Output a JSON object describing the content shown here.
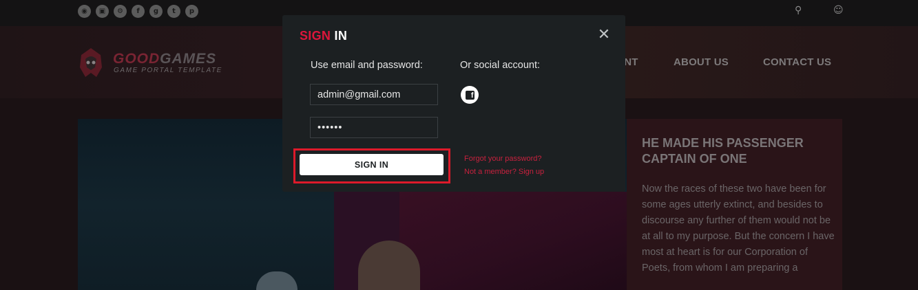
{
  "topbar": {
    "social_icons": [
      {
        "name": "rss-icon",
        "glyph": "◉"
      },
      {
        "name": "twitch-icon",
        "glyph": "▣"
      },
      {
        "name": "steam-icon",
        "glyph": "⚙"
      },
      {
        "name": "facebook-icon",
        "glyph": "f"
      },
      {
        "name": "google-plus-icon",
        "glyph": "g"
      },
      {
        "name": "twitter-icon",
        "glyph": "t"
      },
      {
        "name": "pinterest-icon",
        "glyph": "p"
      }
    ],
    "search_icon": "⚲",
    "user_icon": "☺"
  },
  "logo": {
    "name_part1": "GOOD",
    "name_part2": "GAMES",
    "tagline": "GAME PORTAL TEMPLATE"
  },
  "nav": {
    "partial_item": "ENT",
    "about": "ABOUT US",
    "contact": "CONTACT US"
  },
  "article": {
    "title": "HE MADE HIS PASSENGER CAPTAIN OF ONE",
    "body": "Now the races of these two have been for some ages utterly extinct, and besides to discourse any further of them would not be at all to my purpose. But the concern I have most at heart is for our Corporation of Poets, from whom I am preparing a"
  },
  "modal": {
    "title_part1": "SIGN",
    "title_part2": " IN",
    "close_glyph": "✕",
    "email_label": "Use email and password:",
    "social_label": "Or social account:",
    "email_value": "admin@gmail.com",
    "password_value": "••••••",
    "facebook_glyph": "f",
    "signin_button": "SIGN IN",
    "forgot_link": "Forgot your password?",
    "signup_link": "Not a member? Sign up"
  },
  "colors": {
    "accent": "#dd163b",
    "modal_bg": "#1c2022",
    "highlight": "#dd1a2a"
  }
}
